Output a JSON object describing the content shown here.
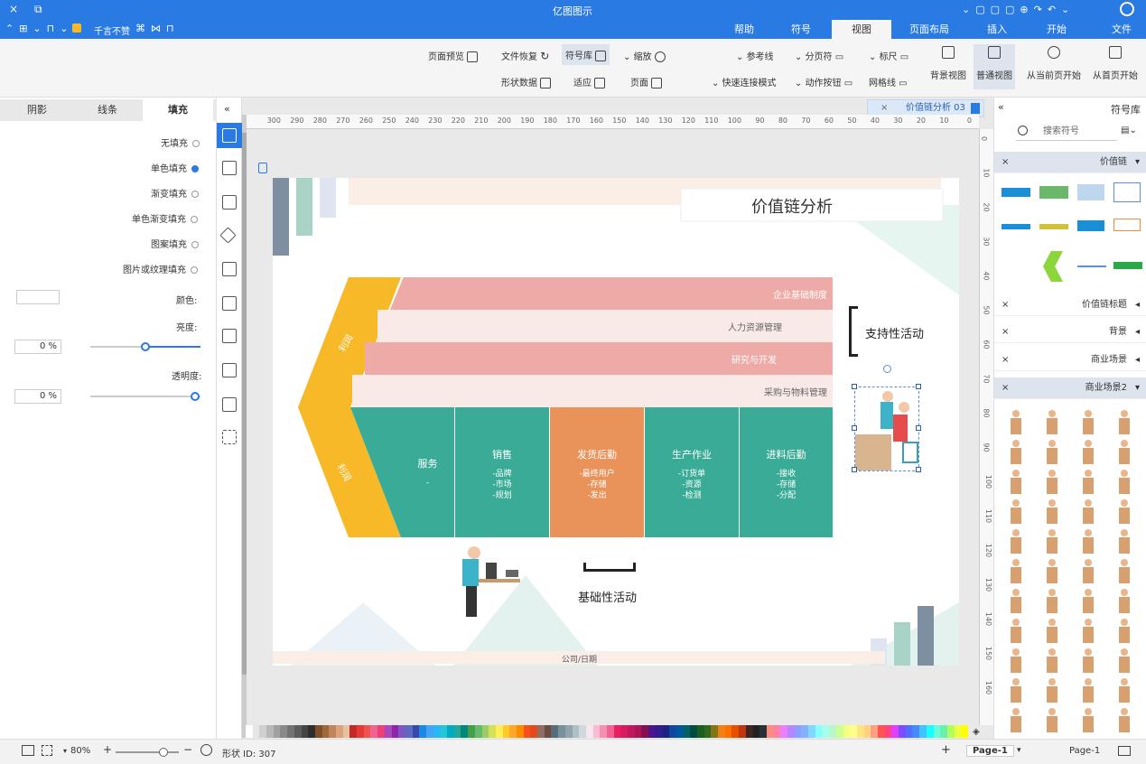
{
  "window": {
    "title": "亿图图示",
    "controls": [
      "×",
      "⧉"
    ]
  },
  "menu_tabs": [
    {
      "label": "文件"
    },
    {
      "label": "开始"
    },
    {
      "label": "插入"
    },
    {
      "label": "页面布局"
    },
    {
      "label": "视图",
      "active": true
    },
    {
      "label": "符号"
    },
    {
      "label": "帮助"
    }
  ],
  "quick": {
    "hint": "千言不赞"
  },
  "ribbon": {
    "from_first": "从首页开始",
    "from_current": "从当前页开始",
    "normal_view": "普通视图",
    "bg_view": "背景视图",
    "ruler": "标尺",
    "gridlines": "网格线",
    "page_break": "分页符",
    "action_btn": "动作按钮",
    "guides": "参考线",
    "quick_connect": "快速连接模式",
    "zoom": "缩放",
    "page": "页面",
    "fit": "适应",
    "symbol_lib": "符号库",
    "file_recovery": "文件恢复",
    "shape_data": "形状数据",
    "page_preview": "页面预览"
  },
  "left_panel": {
    "tabs": [
      "填充",
      "线条",
      "阴影"
    ],
    "fill_options": [
      "无填充",
      "单色填充",
      "渐变填充",
      "单色渐变填充",
      "图案填充",
      "图片或纹理填充"
    ],
    "selected_fill": "单色填充",
    "color_label": "颜色:",
    "brightness_label": "亮度:",
    "brightness_value": "0 %",
    "transparency_label": "透明度:",
    "transparency_value": "0 %"
  },
  "doc_tab": {
    "label": "价值链分析 03"
  },
  "ruler_ticks": [
    "0",
    "10",
    "20",
    "30",
    "40",
    "50",
    "60",
    "70",
    "80",
    "90",
    "100",
    "110",
    "120",
    "130",
    "140",
    "150",
    "160",
    "170",
    "180",
    "190",
    "200",
    "210",
    "220",
    "230",
    "240",
    "250",
    "260",
    "270",
    "280",
    "290",
    "300"
  ],
  "vruler_ticks": [
    "0",
    "10",
    "20",
    "30",
    "40",
    "50",
    "60",
    "70",
    "80",
    "90",
    "100",
    "110",
    "120",
    "130",
    "140",
    "150",
    "160"
  ],
  "diagram": {
    "title": "价值链分析",
    "support_label": "支持性活动",
    "primary_label": "基础性活动",
    "arrow_top": "利润",
    "arrow_bottom": "利润",
    "support_rows": [
      "企业基础制度",
      "人力资源管理",
      "研究与开发",
      "采购与物料管理"
    ],
    "primary_cols": [
      {
        "title": "进料后勤",
        "items": "-接收\n-存储\n-分配"
      },
      {
        "title": "生产作业",
        "items": "-订货单\n-资源\n-检测"
      },
      {
        "title": "发货后勤",
        "items": "-最终用户\n-存储\n-发出"
      },
      {
        "title": "销售",
        "items": "-品牌\n-市场\n-规划"
      },
      {
        "title": "服务",
        "items": "-"
      }
    ],
    "footer": "公司/日期",
    "colors": {
      "pink_dark": "#eeaaa6",
      "pink_light": "#f9e9e7",
      "teal": "#3aab96",
      "orange": "#e9935a",
      "yellow": "#f7b928"
    }
  },
  "right_panel": {
    "title": "符号库",
    "search_placeholder": "搜索符号",
    "categories": [
      "价值链",
      "价值链标题",
      "背景",
      "商业场景",
      "商业场景2"
    ]
  },
  "status": {
    "page_label": "Page-1",
    "page_tab": "Page-1",
    "add": "+",
    "shape_id": "形状 ID: 307",
    "zoom": "80%"
  },
  "palette": [
    "#ffffff",
    "#e6e6e6",
    "#cfcfcf",
    "#b8b8b8",
    "#a1a1a1",
    "#8a8a8a",
    "#737373",
    "#5c5c5c",
    "#454545",
    "#2e2e2e",
    "#7f4f2a",
    "#a0683b",
    "#c0855a",
    "#d9a37d",
    "#e7c2a1",
    "#c62828",
    "#e53935",
    "#ef5350",
    "#f06292",
    "#ec407a",
    "#ab47bc",
    "#8e24aa",
    "#7e57c2",
    "#5c6bc0",
    "#3949ab",
    "#1e88e5",
    "#42a5f5",
    "#29b6f6",
    "#26c6da",
    "#00acc1",
    "#26a69a",
    "#00897b",
    "#43a047",
    "#66bb6a",
    "#9ccc65",
    "#d4e157",
    "#ffee58",
    "#ffca28",
    "#ffa726",
    "#fb8c00",
    "#f4511e",
    "#e64a19",
    "#8d6e63",
    "#6d4c41",
    "#546e7a",
    "#78909c",
    "#90a4ae",
    "#b0bec5",
    "#cfd8dc",
    "#fce4ec",
    "#f8bbd0",
    "#f48fb1",
    "#f06292",
    "#e91e63",
    "#d81b60",
    "#c2185b",
    "#ad1457",
    "#880e4f",
    "#4a148c",
    "#311b92",
    "#1a237e",
    "#0d47a1",
    "#01579b",
    "#006064",
    "#004d40",
    "#1b5e20",
    "#33691e",
    "#827717",
    "#f57f17",
    "#ff6f00",
    "#e65100",
    "#bf360c",
    "#3e2723",
    "#212121",
    "#263238",
    "#ff8a80",
    "#ff80ab",
    "#ea80fc",
    "#b388ff",
    "#8c9eff",
    "#82b1ff",
    "#80d8ff",
    "#84ffff",
    "#a7ffeb",
    "#b9f6ca",
    "#ccff90",
    "#f4ff81",
    "#ffff8d",
    "#ffe57f",
    "#ffd180",
    "#ff9e80",
    "#ff5252",
    "#ff4081",
    "#e040fb",
    "#7c4dff",
    "#536dfe",
    "#448aff",
    "#40c4ff",
    "#18ffff",
    "#64ffda",
    "#69f0ae",
    "#b2ff59",
    "#eeff41",
    "#ffff00"
  ]
}
